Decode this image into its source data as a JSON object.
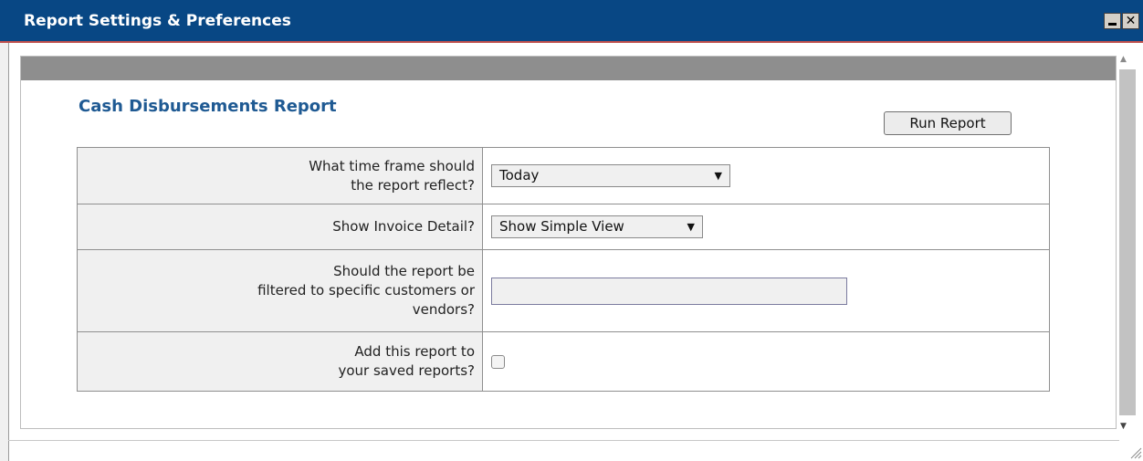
{
  "window": {
    "title": "Report Settings & Preferences",
    "minimize_label": "_",
    "close_label": "✕"
  },
  "report": {
    "title": "Cash Disbursements Report",
    "run_button_label": "Run Report"
  },
  "form": {
    "rows": [
      {
        "label_line1": "What time frame should",
        "label_line2": "the report reflect?",
        "select_value": "Today"
      },
      {
        "label": "Show Invoice Detail?",
        "select_value": "Show Simple View"
      },
      {
        "label_line1": "Should the report be",
        "label_line2": "filtered to specific customers or",
        "label_line3": "vendors?",
        "input_value": ""
      },
      {
        "label_line1": "Add this report to",
        "label_line2": "your saved reports?",
        "checked": false
      }
    ]
  },
  "icons": {
    "select_arrow": "▼",
    "scroll_up": "▲",
    "scroll_down": "▼"
  }
}
